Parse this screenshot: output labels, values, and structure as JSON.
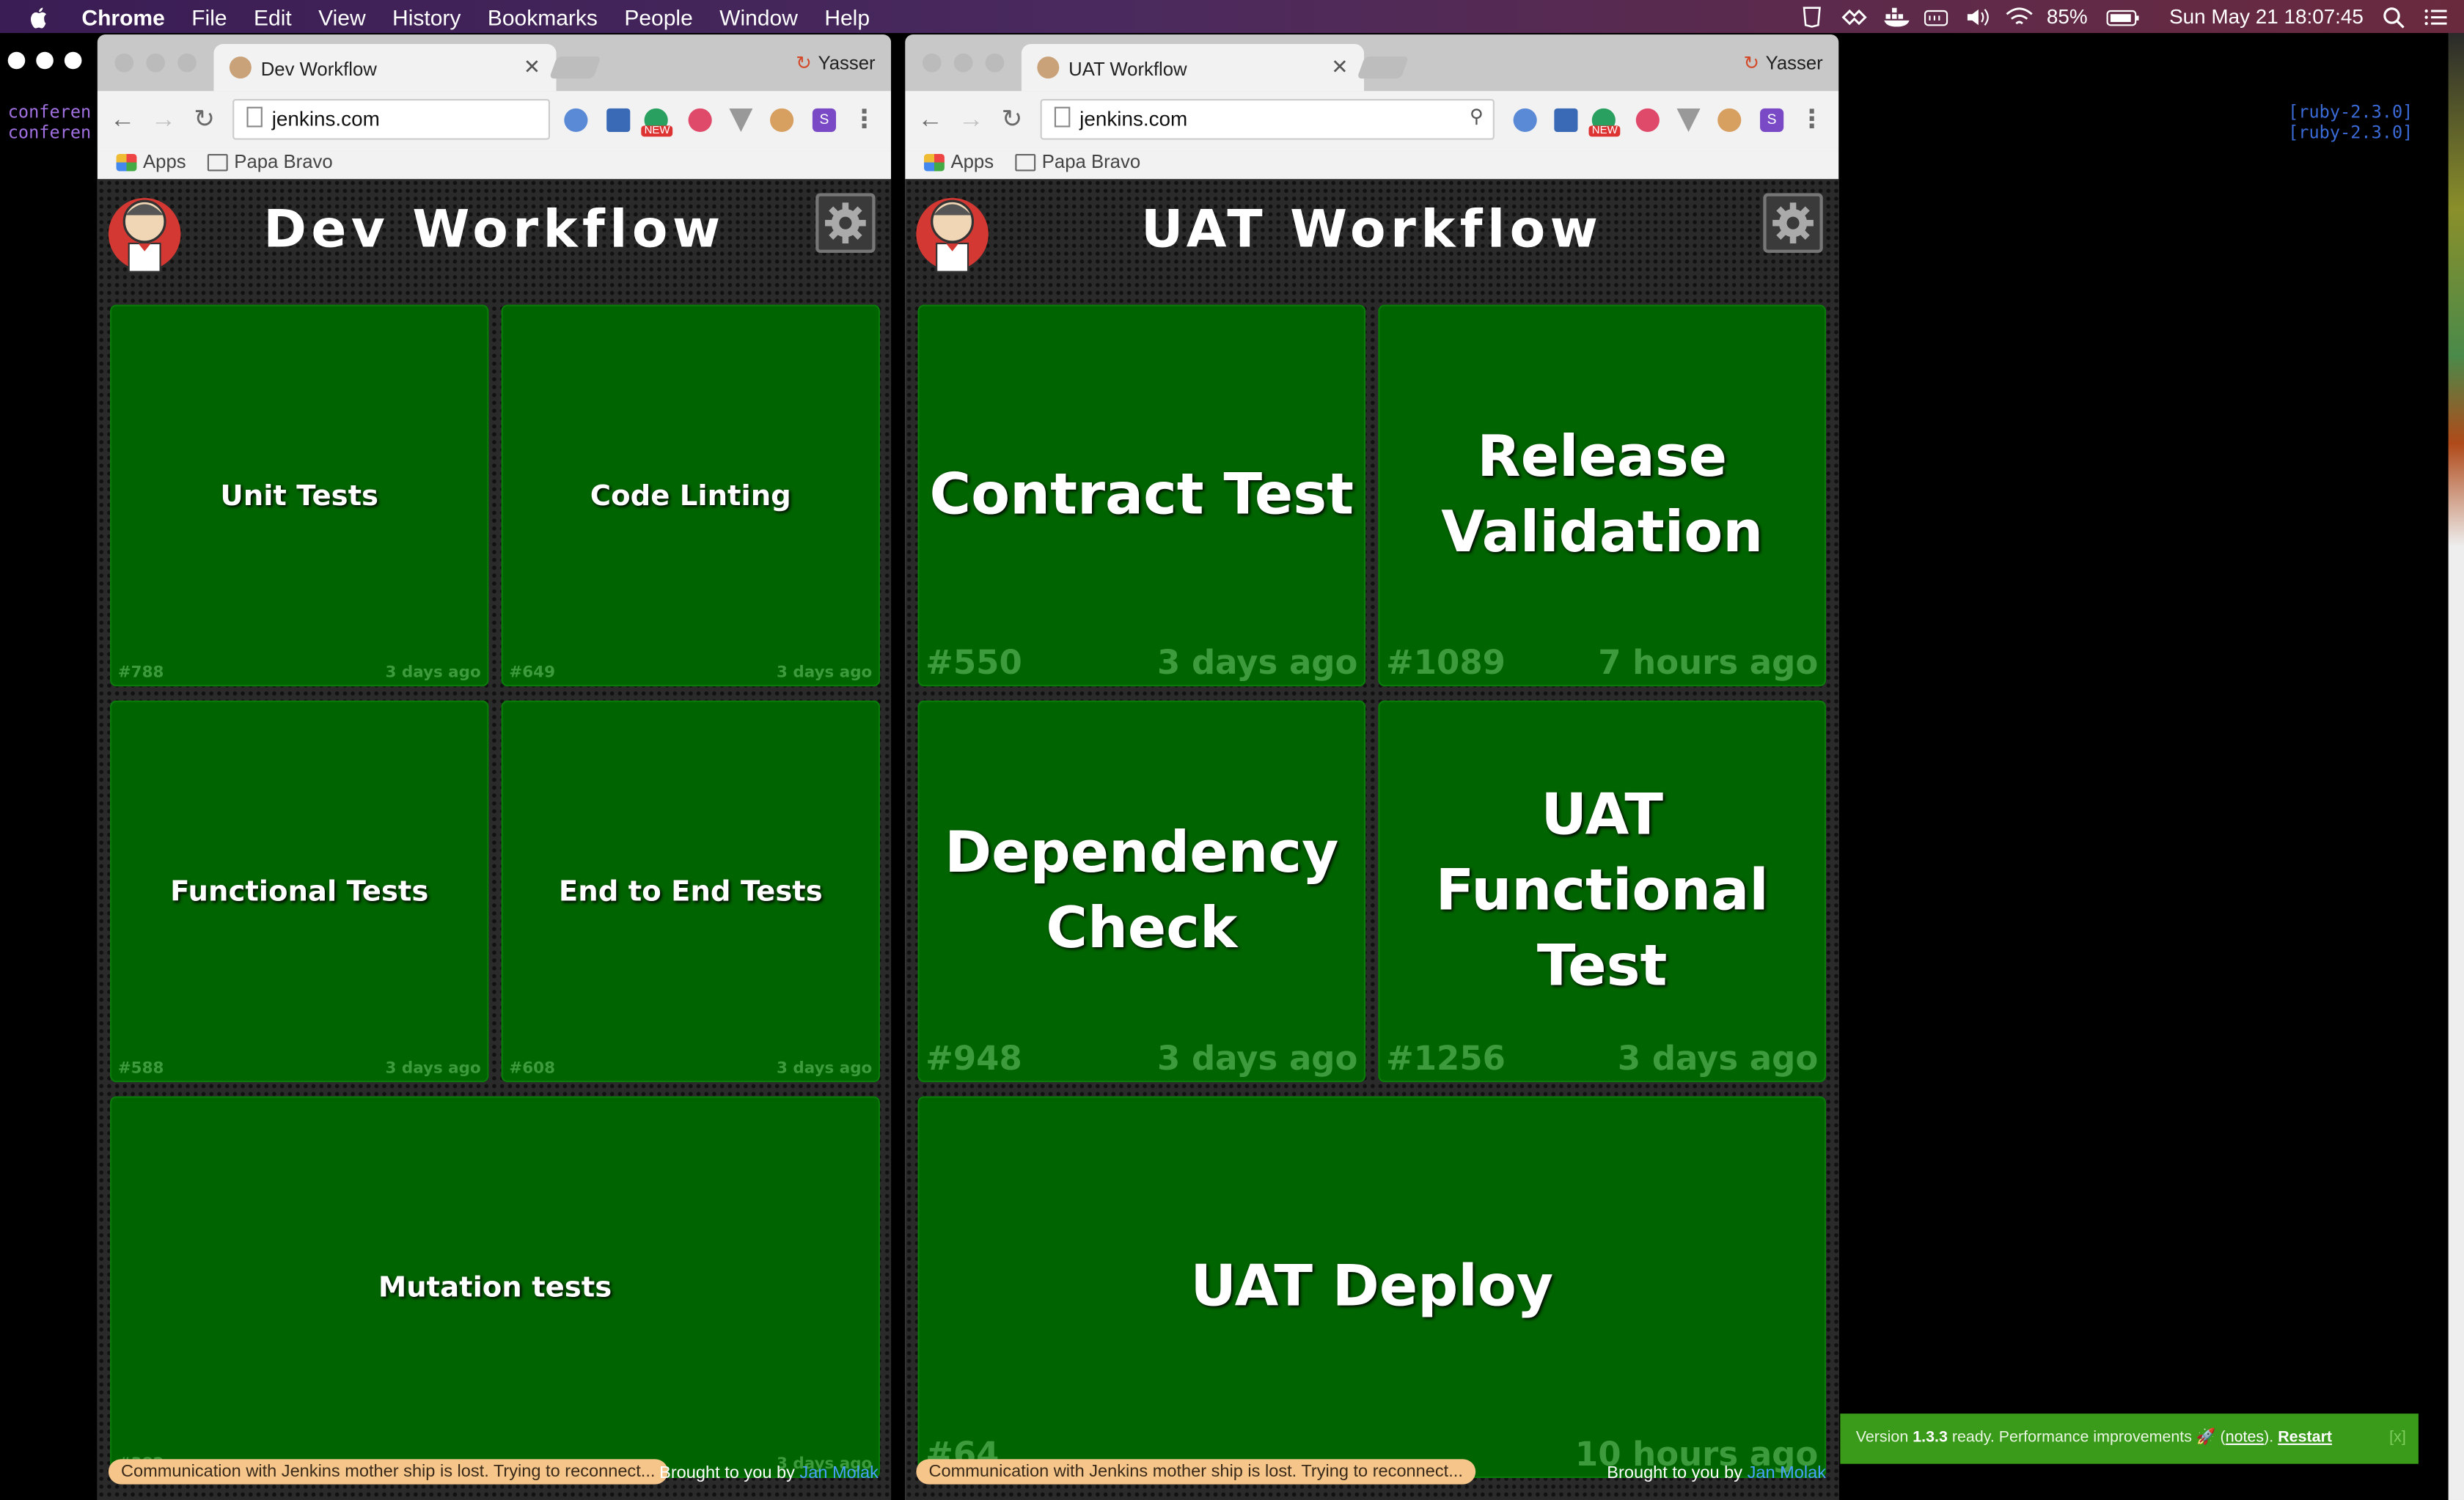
{
  "menubar": {
    "app": "Chrome",
    "items": [
      "File",
      "Edit",
      "View",
      "History",
      "Bookmarks",
      "People",
      "Window",
      "Help"
    ],
    "battery": "85%",
    "datetime": "Sun May 21  18:07:45"
  },
  "terminal": {
    "left_lines": [
      "conferen",
      "conferen"
    ],
    "right_lines": [
      "[ruby-2.3.0]",
      "[ruby-2.3.0]"
    ]
  },
  "browser": {
    "bookmark_apps": "Apps",
    "bookmark_folder": "Papa Bravo",
    "profile": "Yasser",
    "new_badge": "NEW",
    "ext_s": "S"
  },
  "windows": [
    {
      "tab_title": "Dev Workflow",
      "url": "jenkins.com",
      "dashboard_title": "Dev Workflow",
      "status": "Communication with Jenkins mother ship is lost. Trying to reconnect...",
      "credit_prefix": "Brought to you by ",
      "credit_author": "Jan Molak",
      "tiles": [
        {
          "name": "Unit Tests",
          "build": "#788",
          "ago": "3 days ago"
        },
        {
          "name": "Code Linting",
          "build": "#649",
          "ago": "3 days ago"
        },
        {
          "name": "Functional Tests",
          "build": "#588",
          "ago": "3 days ago"
        },
        {
          "name": "End to End Tests",
          "build": "#608",
          "ago": "3 days ago"
        },
        {
          "name": "Mutation tests",
          "build": "#382",
          "ago": "3 days ago"
        }
      ]
    },
    {
      "tab_title": "UAT Workflow",
      "url": "jenkins.com",
      "dashboard_title": "UAT Workflow",
      "status": "Communication with Jenkins mother ship is lost. Trying to reconnect...",
      "credit_prefix": "Brought to you by ",
      "credit_author": "Jan Molak",
      "tiles": [
        {
          "name": "Contract Test",
          "build": "#550",
          "ago": "3 days ago"
        },
        {
          "name": "Release Validation",
          "build": "#1089",
          "ago": "7 hours ago"
        },
        {
          "name": "Dependency Check",
          "build": "#948",
          "ago": "3 days ago"
        },
        {
          "name": "UAT Functional Test",
          "build": "#1256",
          "ago": "3 days ago"
        },
        {
          "name": "UAT Deploy",
          "build": "#64",
          "ago": "10 hours ago"
        }
      ]
    }
  ],
  "notification": {
    "prefix": "Version ",
    "version": "1.3.3",
    "message": " ready. Performance improvements 🚀 (",
    "notes": "notes",
    "suffix": "). ",
    "restart": "Restart",
    "close": "[x]"
  },
  "colors": {
    "tile_green": "#006400",
    "tile_meta": "#3d9a3d",
    "status_bg": "#f5c58a",
    "notify_bg": "#3a9a1a",
    "link": "#4aa0ff"
  }
}
